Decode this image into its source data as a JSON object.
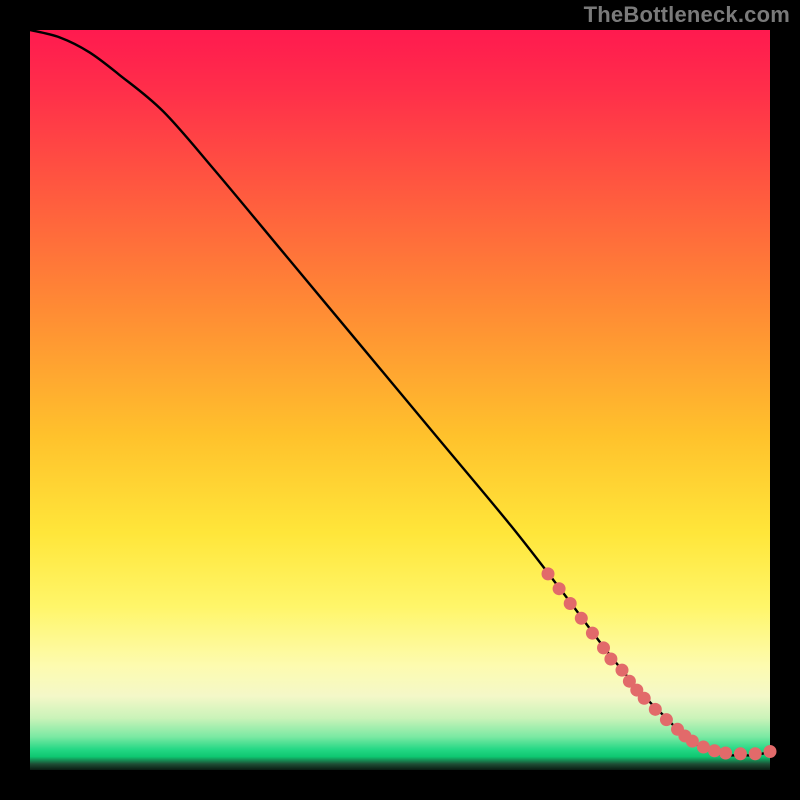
{
  "attribution": "TheBottleneck.com",
  "chart_data": {
    "type": "line",
    "title": "",
    "xlabel": "",
    "ylabel": "",
    "xlim": [
      0,
      100
    ],
    "ylim": [
      0,
      100
    ],
    "series": [
      {
        "name": "curve",
        "x": [
          0,
          4,
          8,
          12,
          18,
          25,
          35,
          45,
          55,
          65,
          72,
          78,
          83,
          86,
          88,
          90,
          92,
          94,
          96,
          98,
          100
        ],
        "values": [
          100,
          99,
          97,
          94,
          89,
          81,
          69,
          57,
          45,
          33,
          24,
          16,
          10,
          7,
          5,
          3.5,
          2.5,
          2,
          2,
          2,
          2.5
        ]
      }
    ],
    "highlight_points": {
      "name": "dots",
      "color": "#e26a6a",
      "x": [
        70,
        71.5,
        73,
        74.5,
        76,
        77.5,
        78.5,
        80,
        81,
        82,
        83,
        84.5,
        86,
        87.5,
        88.5,
        89.5,
        91,
        92.5,
        94,
        96,
        98,
        100
      ],
      "values": [
        26.5,
        24.5,
        22.5,
        20.5,
        18.5,
        16.5,
        15,
        13.5,
        12,
        10.8,
        9.7,
        8.2,
        6.8,
        5.5,
        4.6,
        3.9,
        3.1,
        2.6,
        2.3,
        2.2,
        2.2,
        2.5
      ]
    },
    "colors": {
      "gradient_stops": [
        {
          "pos": 0,
          "hex": "#ff1a4f"
        },
        {
          "pos": 0.22,
          "hex": "#ff5a3f"
        },
        {
          "pos": 0.55,
          "hex": "#ffc22c"
        },
        {
          "pos": 0.78,
          "hex": "#fff66a"
        },
        {
          "pos": 0.95,
          "hex": "#7be9a3"
        },
        {
          "pos": 0.982,
          "hex": "#0ec771"
        },
        {
          "pos": 1.0,
          "hex": "#0a1c12"
        }
      ]
    }
  }
}
